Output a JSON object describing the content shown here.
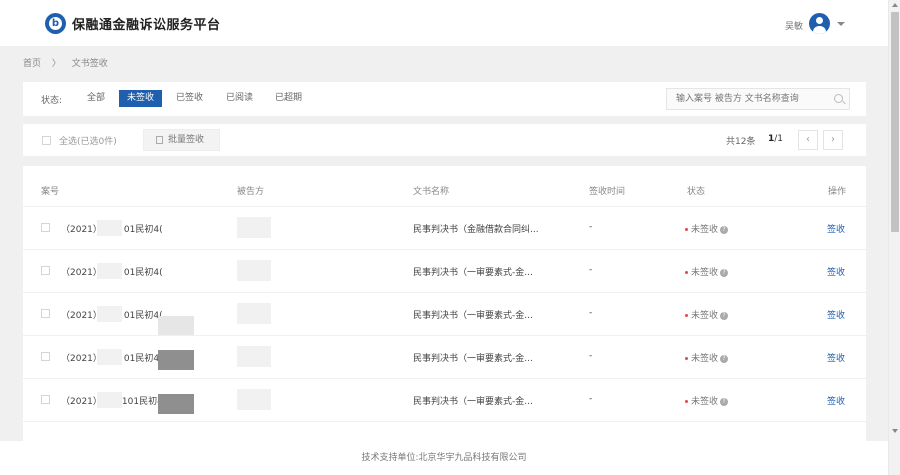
{
  "header": {
    "logo_text": "b",
    "app_title": "保融通金融诉讼服务平台",
    "user_name": "吴敏"
  },
  "breadcrumb": [
    "首页",
    "〉",
    "文书签收"
  ],
  "filter": {
    "status_label": "状态:",
    "tabs": [
      "全部",
      "未签收",
      "已签收",
      "已阅读",
      "已超期"
    ],
    "active_tab": "未签收",
    "search_placeholder": "输入案号 被告方 文书名称查询"
  },
  "actions": {
    "select_all": "全选(已选0件)",
    "batch_sign": "批量签收",
    "total": "共12条",
    "current_page": "1",
    "total_pages": "/1",
    "prev": "‹",
    "next": "›"
  },
  "table": {
    "columns": [
      "案号",
      "被告方",
      "文书名称",
      "签收时间",
      "状态",
      "操作"
    ],
    "rows": [
      {
        "case_prefix": "（2021）",
        "case_suffix": "01民初4(",
        "doc_name": "民事判决书（金融借款合同纠...",
        "sign_time": "-",
        "status": "未签收",
        "action": "签收"
      },
      {
        "case_prefix": "（2021）",
        "case_suffix": "01民初4(",
        "doc_name": "民事判决书（一审要素式-金...",
        "sign_time": "-",
        "status": "未签收",
        "action": "签收"
      },
      {
        "case_prefix": "（2021）",
        "case_suffix": "01民初4(",
        "doc_name": "民事判决书（一审要素式-金...",
        "sign_time": "-",
        "status": "未签收",
        "action": "签收"
      },
      {
        "case_prefix": "（2021）",
        "case_suffix": "01民初4(",
        "doc_name": "民事判决书（一审要素式-金...",
        "sign_time": "-",
        "status": "未签收",
        "action": "签收"
      },
      {
        "case_prefix": "（2021）",
        "case_suffix": "101民初4(",
        "doc_name": "民事判决书（一审要素式-金...",
        "sign_time": "-",
        "status": "未签收",
        "action": "签收"
      }
    ]
  },
  "footer": {
    "text": "技术支持单位:北京华宇九品科技有限公司"
  },
  "colors": {
    "primary": "#1f5fad",
    "status_dot": "#e04848"
  }
}
